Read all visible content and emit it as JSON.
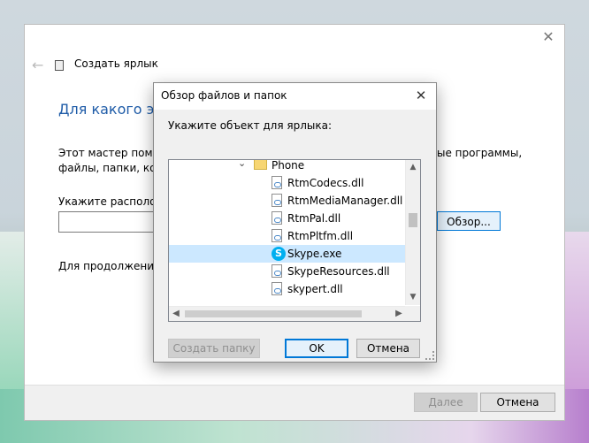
{
  "wizard": {
    "title": "Создать ярлык",
    "heading": "Для какого эле",
    "description_line1": "Этот мастер помога",
    "description_line2": "файлы, папки, комп",
    "description_right": "ые программы,",
    "location_label": "Укажите расположе",
    "browse_label": "Обзор...",
    "continue_label": "Для продолжения н",
    "next_label": "Далее",
    "cancel_label": "Отмена"
  },
  "dialog": {
    "title": "Обзор файлов и папок",
    "prompt": "Укажите объект для ярлыка:",
    "tree_items": [
      {
        "label": "Phone",
        "type": "folder",
        "expanded": true,
        "selected": false
      },
      {
        "label": "RtmCodecs.dll",
        "type": "dll",
        "selected": false
      },
      {
        "label": "RtmMediaManager.dll",
        "type": "dll",
        "selected": false
      },
      {
        "label": "RtmPal.dll",
        "type": "dll",
        "selected": false
      },
      {
        "label": "RtmPltfm.dll",
        "type": "dll",
        "selected": false
      },
      {
        "label": "Skype.exe",
        "type": "skype",
        "selected": true
      },
      {
        "label": "SkypeResources.dll",
        "type": "dll",
        "selected": false
      },
      {
        "label": "skypert.dll",
        "type": "dll",
        "selected": false
      }
    ],
    "new_folder_label": "Создать папку",
    "ok_label": "OK",
    "cancel_label": "Отмена"
  },
  "colors": {
    "accent": "#0078d7",
    "heading": "#1f5ca8",
    "selection": "#cce8ff",
    "skype": "#00aff0"
  }
}
